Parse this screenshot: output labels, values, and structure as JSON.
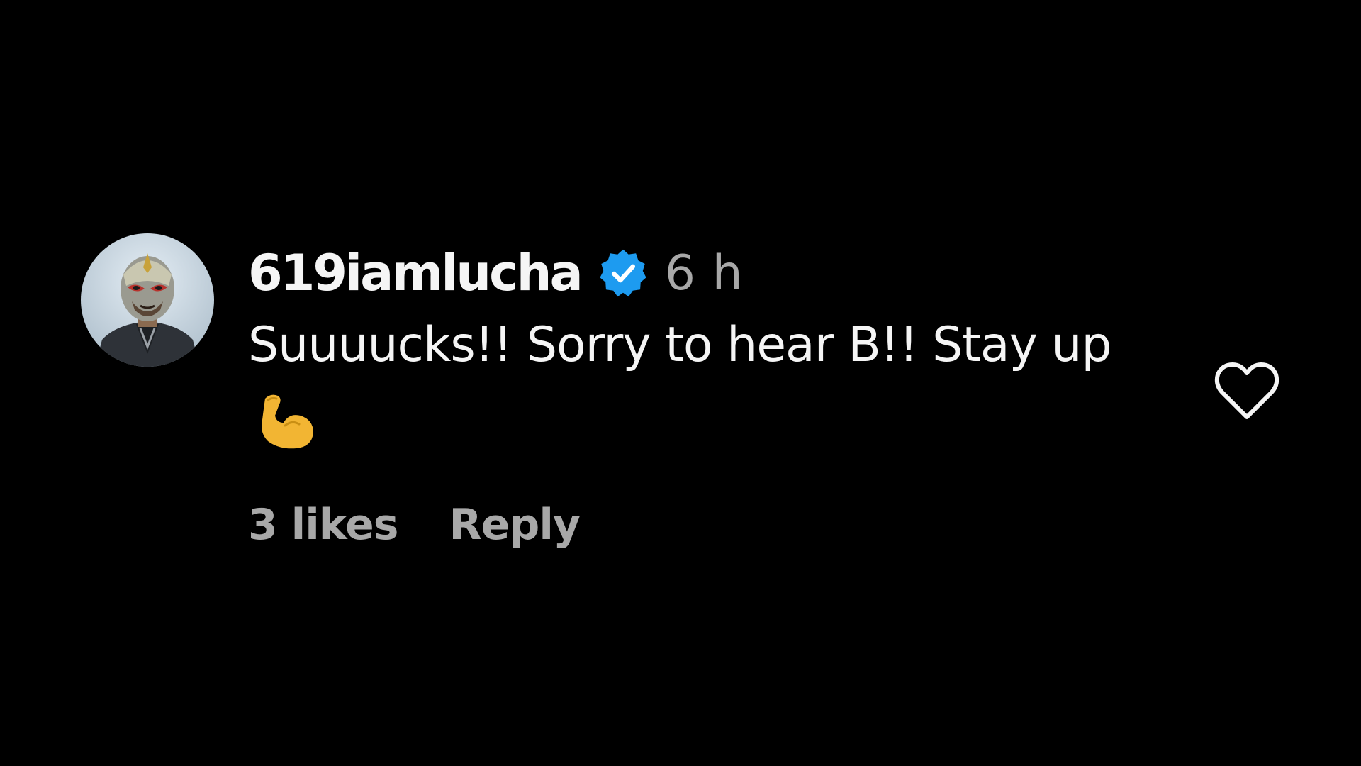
{
  "comment": {
    "username": "619iamlucha",
    "verified": true,
    "timestamp": "6 h",
    "text": "Suuuucks!! Sorry to hear B!! Stay up",
    "emoji": "flexed-biceps",
    "likes_label": "3 likes",
    "reply_label": "Reply",
    "liked": false
  },
  "icons": {
    "verified": "verified-badge-icon",
    "like": "heart-outline-icon"
  },
  "colors": {
    "background": "#000000",
    "primary_text": "#f5f5f5",
    "secondary_text": "#a8a8a8",
    "verified_badge": "#1d9bf0",
    "emoji": "#f2b533"
  }
}
